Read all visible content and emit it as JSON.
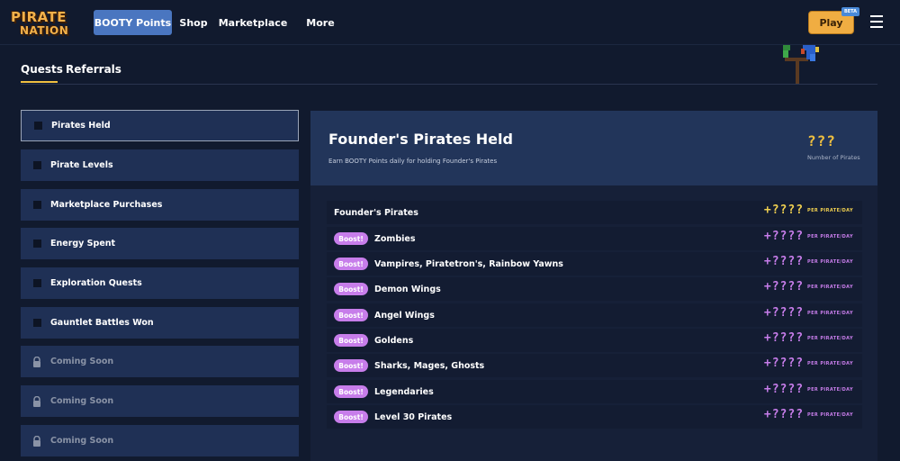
{
  "header": {
    "logo_line1": "PIRATE",
    "logo_line2": "NATION",
    "nav": [
      {
        "label": "BOOTY Points",
        "active": true
      },
      {
        "label": "Shop"
      },
      {
        "label": "Marketplace"
      },
      {
        "label": "More"
      }
    ],
    "play_label": "Play",
    "beta_label": "BETA"
  },
  "tabs": [
    {
      "label": "Quests",
      "active": true
    },
    {
      "label": "Referrals"
    }
  ],
  "sidebar": {
    "items": [
      {
        "label": "Pirates Held",
        "state": "selected"
      },
      {
        "label": "Pirate Levels",
        "state": "open"
      },
      {
        "label": "Marketplace Purchases",
        "state": "open"
      },
      {
        "label": "Energy Spent",
        "state": "open"
      },
      {
        "label": "Exploration Quests",
        "state": "open"
      },
      {
        "label": "Gauntlet Battles Won",
        "state": "open"
      },
      {
        "label": "Coming Soon",
        "state": "locked"
      },
      {
        "label": "Coming Soon",
        "state": "locked"
      },
      {
        "label": "Coming Soon",
        "state": "locked"
      }
    ]
  },
  "panel": {
    "title": "Founder's Pirates Held",
    "subtitle": "Earn BOOTY Points daily for holding Founder's Pirates",
    "count_value": "???",
    "count_label": "Number of Pirates",
    "boost_label": "Boost!",
    "rows": [
      {
        "name": "Founder's Pirates",
        "boost": false,
        "amount": "+????",
        "unit": "PER PIRATE/DAY",
        "color": "#f0d050"
      },
      {
        "name": "Zombies",
        "boost": true,
        "amount": "+????",
        "unit": "PER PIRATE/DAY",
        "color": "#c77dea"
      },
      {
        "name": "Vampires, Piratetron's, Rainbow Yawns",
        "boost": true,
        "amount": "+????",
        "unit": "PER PIRATE/DAY",
        "color": "#c77dea"
      },
      {
        "name": "Demon Wings",
        "boost": true,
        "amount": "+????",
        "unit": "PER PIRATE/DAY",
        "color": "#c77dea"
      },
      {
        "name": "Angel Wings",
        "boost": true,
        "amount": "+????",
        "unit": "PER PIRATE/DAY",
        "color": "#c77dea"
      },
      {
        "name": "Goldens",
        "boost": true,
        "amount": "+????",
        "unit": "PER PIRATE/DAY",
        "color": "#c77dea"
      },
      {
        "name": "Sharks, Mages, Ghosts",
        "boost": true,
        "amount": "+????",
        "unit": "PER PIRATE/DAY",
        "color": "#c77dea"
      },
      {
        "name": "Legendaries",
        "boost": true,
        "amount": "+????",
        "unit": "PER PIRATE/DAY",
        "color": "#c77dea"
      },
      {
        "name": "Level 30 Pirates",
        "boost": true,
        "amount": "+????",
        "unit": "PER PIRATE/DAY",
        "color": "#c77dea"
      }
    ]
  },
  "colors": {
    "background": "#111a2e",
    "accent_blue": "#4a76c0",
    "play_orange": "#f0ad42",
    "gold": "#f0d050",
    "boost_purple": "#c77dea"
  },
  "icons": [
    "menu-icon",
    "lock-icon",
    "parrot-icon",
    "checkbox-icon"
  ]
}
